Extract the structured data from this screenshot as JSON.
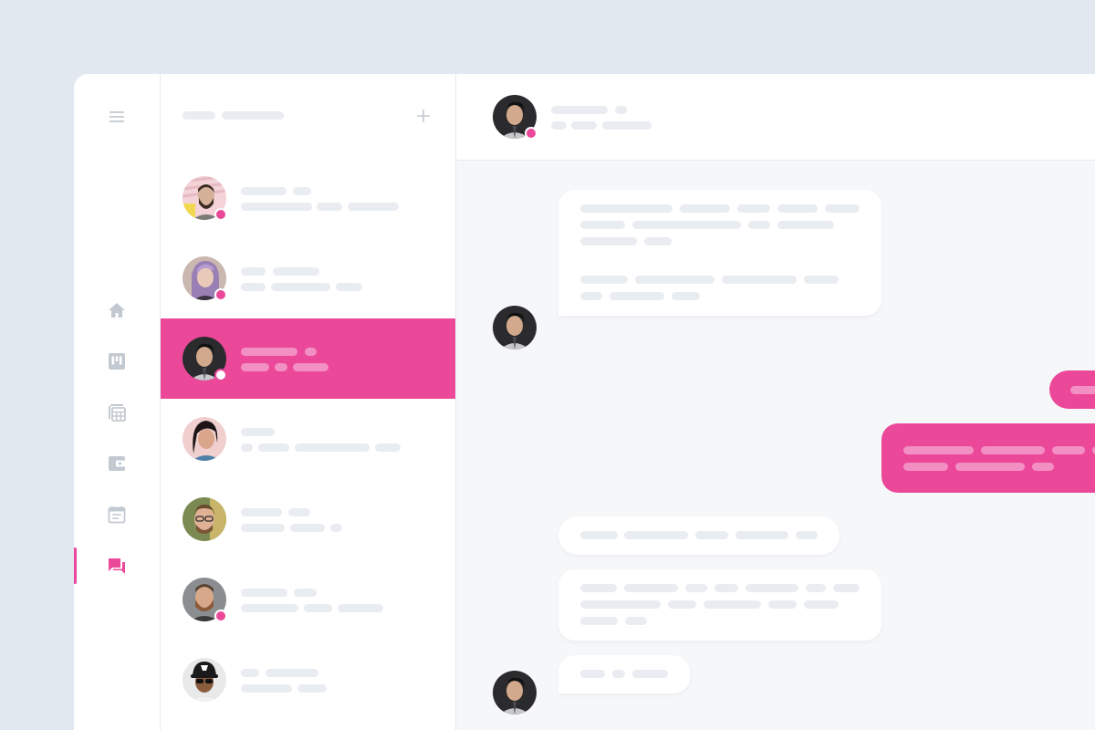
{
  "window": {
    "background": "#e1e8f0",
    "accent": "#eb4899"
  },
  "rail": {
    "items": [
      {
        "icon": "menu-icon"
      },
      {
        "icon": "home-icon"
      },
      {
        "icon": "board-icon"
      },
      {
        "icon": "spreadsheet-icon"
      },
      {
        "icon": "wallet-icon"
      },
      {
        "icon": "calendar-icon"
      },
      {
        "icon": "chat-icon",
        "active": true
      }
    ]
  },
  "list": {
    "add_icon": "plus-icon",
    "conversations": [
      {
        "avatar": "avatar-1",
        "online": true,
        "active": false
      },
      {
        "avatar": "avatar-2",
        "online": true,
        "active": false
      },
      {
        "avatar": "avatar-3",
        "online": true,
        "active": true
      },
      {
        "avatar": "avatar-4",
        "online": false,
        "active": false
      },
      {
        "avatar": "avatar-5",
        "online": false,
        "active": false
      },
      {
        "avatar": "avatar-6",
        "online": true,
        "active": false
      },
      {
        "avatar": "avatar-7",
        "online": false,
        "active": false
      }
    ]
  },
  "chat": {
    "contact_avatar": "avatar-3",
    "contact_online": true,
    "messages": [
      {
        "direction": "incoming"
      },
      {
        "direction": "outgoing"
      },
      {
        "direction": "outgoing"
      },
      {
        "direction": "incoming"
      },
      {
        "direction": "incoming"
      },
      {
        "direction": "incoming"
      }
    ]
  }
}
